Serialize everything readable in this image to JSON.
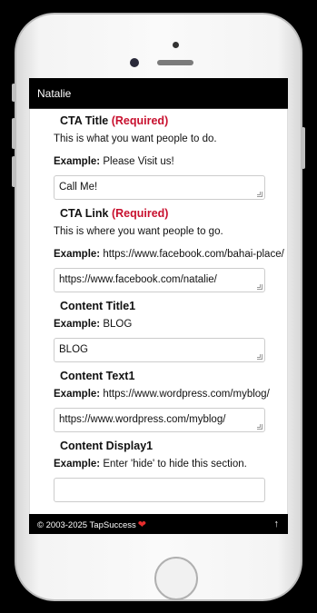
{
  "header": {
    "title": "Natalie"
  },
  "fields": [
    {
      "title": "CTA Title",
      "required": "(Required)",
      "description": "This is what you want people to do.",
      "example_label": "Example:",
      "example_text": "Please Visit us!",
      "value": "Call Me!"
    },
    {
      "title": "CTA Link",
      "required": "(Required)",
      "description": "This is where you want people to go.",
      "example_label": "Example:",
      "example_text": "https://www.facebook.com/bahai-place/",
      "value": "https://www.facebook.com/natalie/"
    },
    {
      "title": "Content Title1",
      "example_label": "Example:",
      "example_text": "BLOG",
      "value": "BLOG"
    },
    {
      "title": "Content Text1",
      "example_label": "Example:",
      "example_text": "https://www.wordpress.com/myblog/",
      "value": "https://www.wordpress.com/myblog/"
    },
    {
      "title": "Content Display1",
      "example_label": "Example:",
      "example_text": "Enter 'hide' to hide this section.",
      "value": ""
    }
  ],
  "footer": {
    "copyright": "© 2003-2025 TapSuccess",
    "heart_icon": "heart-icon",
    "top_icon": "arrow-up-icon",
    "heart_color": "#e52d2d"
  }
}
